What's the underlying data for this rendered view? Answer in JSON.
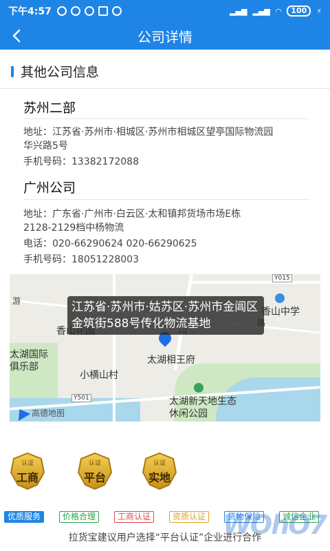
{
  "statusbar": {
    "time": "下午4:57",
    "network": "HD",
    "battery": "100"
  },
  "header": {
    "back_icon": "chevron-left-icon",
    "title": "公司详情",
    "color": "#1e84e6"
  },
  "section": {
    "title": "其他公司信息"
  },
  "companies": [
    {
      "name": "苏州二部",
      "address_line1": "地址：江苏省·苏州市·相城区·苏州市相城区望亭国际物流园",
      "address_line2": "华兴路5号",
      "mobile": "手机号码：13382172088"
    },
    {
      "name": "广州公司",
      "address_line1": "地址：广东省·广州市·白云区·太和镇邦货场市场E栋",
      "address_line2": "2128-2129档中杨物流",
      "phone": "电话：020-66290624 020-66290625",
      "mobile": "手机号码：18051228003"
    }
  ],
  "map": {
    "tooltip": "江苏省·苏州市·姑苏区·苏州市金阊区金筑街588号传化物流基地",
    "labels": {
      "xiangshan_garden": "香山花园",
      "taihu_xiangwangfu": "太湖相王府",
      "xiaohengshan": "小横山村",
      "taihu_club": "太湖国际俱乐部",
      "xiangshan_school": "香山中学",
      "leisure_park": "太湖新天地生态休闲公园",
      "you": "游",
      "lu": "路",
      "shan": "山",
      "y015": "Y015",
      "y501": "Y501",
      "logo": "高德地图"
    }
  },
  "badges": [
    {
      "top": "认证",
      "main": "工商"
    },
    {
      "top": "认证",
      "main": "平台"
    },
    {
      "top": "认证",
      "main": "实地"
    }
  ],
  "tags": [
    {
      "label": "优质服务",
      "color": "#1e84e6",
      "filled": true
    },
    {
      "label": "价格合理",
      "color": "#2aa34a",
      "filled": false
    },
    {
      "label": "工商认证",
      "color": "#e04848",
      "filled": false
    },
    {
      "label": "资质认证",
      "color": "#e8a020",
      "filled": false
    },
    {
      "label": "货物保险",
      "color": "#1e84e6",
      "filled": false
    },
    {
      "label": "诚信企业",
      "color": "#2aa34a",
      "filled": false
    }
  ],
  "notice": "拉货宝建议用户选择“平台认证”企业进行合作",
  "watermark": "WOhO7"
}
